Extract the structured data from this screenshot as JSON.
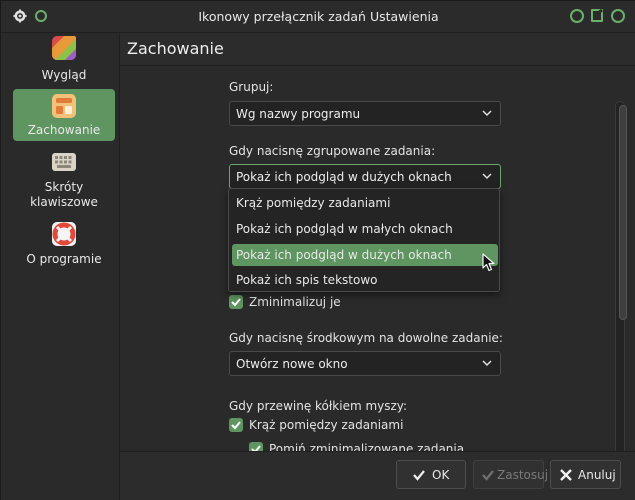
{
  "window": {
    "title": "Ikonowy przełącznik zadań Ustawienia"
  },
  "sidebar": {
    "items": [
      {
        "label": "Wygląd",
        "icon": "appearance-icon"
      },
      {
        "label": "Zachowanie",
        "icon": "behavior-icon"
      },
      {
        "label": "Skróty klawiszowe",
        "icon": "keyboard-icon"
      },
      {
        "label": "O programie",
        "icon": "help-lifebuoy-icon"
      }
    ]
  },
  "page": {
    "title": "Zachowanie"
  },
  "form": {
    "group_label": "Grupuj:",
    "group_value": "Wg nazwy programu",
    "grouped_click_label": "Gdy nacisnę zgrupowane zadania:",
    "grouped_click_value": "Pokaż ich podgląd w dużych oknach",
    "grouped_click_options": [
      "Krąż pomiędzy zadaniami",
      "Pokaż ich podgląd w małych oknach",
      "Pokaż ich podgląd w dużych oknach",
      "Pokaż ich spis tekstowo"
    ],
    "minimize_label": "Zminimalizuj je",
    "middle_click_label": "Gdy nacisnę środkowym na dowolne zadanie:",
    "middle_click_value": "Otwórz nowe okno",
    "wheel_label": "Gdy przewinę kółkiem myszy:",
    "wheel_cycle_label": "Krąż pomiędzy zadaniami",
    "wheel_skip_label": "Pomiń zminimalizowane zadania"
  },
  "buttons": {
    "ok": "OK",
    "apply": "Zastosuj",
    "cancel": "Anuluj"
  },
  "colors": {
    "accent": "#5f9560",
    "window_bg": "#2a2a2a"
  }
}
